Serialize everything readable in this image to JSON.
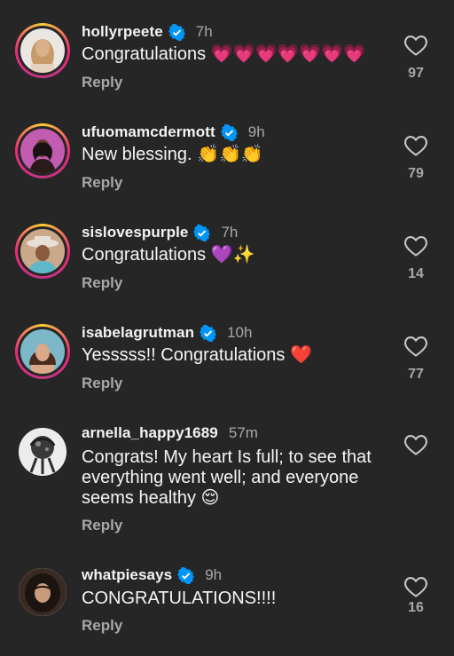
{
  "comments": [
    {
      "username": "hollyrpeete",
      "verified": true,
      "time": "7h",
      "text": "Congratulations 💗💗💗💗💗💗💗",
      "reply": "Reply",
      "likes": "97",
      "avatar": "story"
    },
    {
      "username": "ufuomamcdermott",
      "verified": true,
      "time": "9h",
      "text": "New blessing. 👏👏👏",
      "reply": "Reply",
      "likes": "79",
      "avatar": "story"
    },
    {
      "username": "sislovespurple",
      "verified": true,
      "time": "7h",
      "text": "Congratulations 💜✨",
      "reply": "Reply",
      "likes": "14",
      "avatar": "story"
    },
    {
      "username": "isabelagrutman",
      "verified": true,
      "time": "10h",
      "text": "Yesssss!! Congratulations ❤️",
      "reply": "Reply",
      "likes": "77",
      "avatar": "story"
    },
    {
      "username": "arnella_happy1689",
      "verified": false,
      "time": "57m",
      "text": "Congrats! My heart Is full; to see that everything went well; and everyone seems healthy 😌",
      "reply": "Reply",
      "likes": "",
      "avatar": "plain"
    },
    {
      "username": "whatpiesays",
      "verified": true,
      "time": "9h",
      "text": "CONGRATULATIONS!!!!",
      "reply": "Reply",
      "likes": "16",
      "avatar": "plain"
    }
  ],
  "colors": {
    "background": "#262626",
    "secondary_text": "#a8a8a8",
    "verified_blue": "#0095f6"
  },
  "icons": {
    "verified": "verified-badge-icon",
    "like": "heart-outline-icon"
  }
}
